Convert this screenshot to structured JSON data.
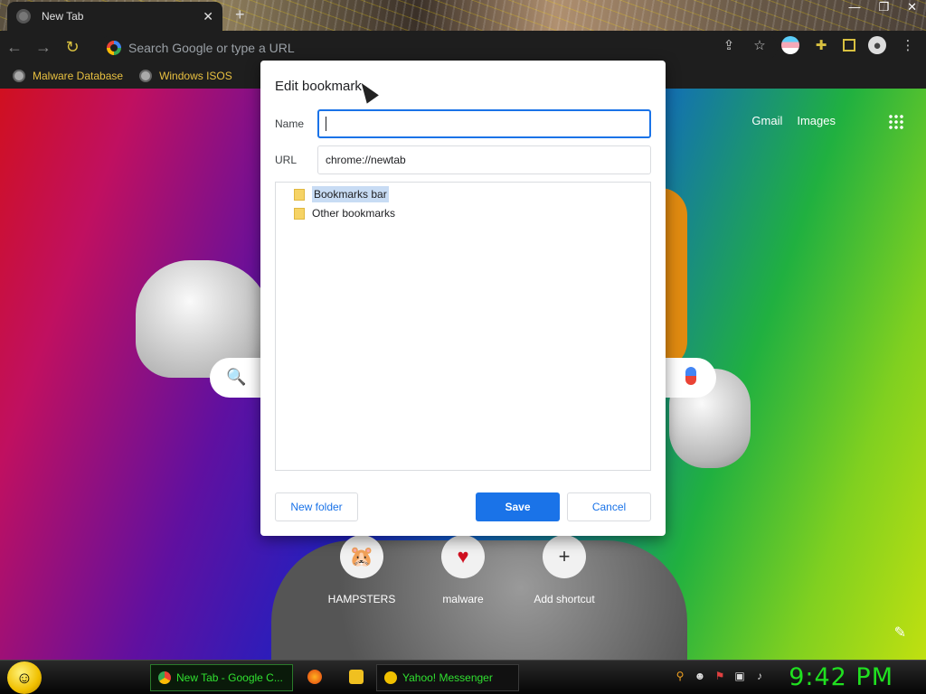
{
  "browser": {
    "tab_title": "New Tab",
    "tab_close": "✕",
    "new_tab": "+",
    "window_controls": [
      "—",
      "❐",
      "✕"
    ],
    "omnibox_placeholder": "Search Google or type a URL",
    "bookmarks": [
      "Malware Database",
      "Windows ISOS"
    ]
  },
  "ntp": {
    "gmail": "Gmail",
    "images": "Images",
    "shortcuts": [
      {
        "label": "HAMPSTERS",
        "icon": "🐹"
      },
      {
        "label": "malware",
        "icon": "♥"
      },
      {
        "label": "Add shortcut",
        "icon": "+"
      }
    ]
  },
  "dialog": {
    "title": "Edit bookmark",
    "name_label": "Name",
    "name_value": "",
    "url_label": "URL",
    "url_value": "chrome://newtab",
    "folders": [
      "Bookmarks bar",
      "Other bookmarks"
    ],
    "selected_folder": "Bookmarks bar",
    "new_folder_label": "New folder",
    "save_label": "Save",
    "cancel_label": "Cancel"
  },
  "taskbar": {
    "tasks": [
      {
        "label": "New Tab - Google C..."
      },
      {
        "label": "Yahoo! Messenger"
      }
    ],
    "clock": "9:42 PM"
  },
  "colors": {
    "accent": "#1a73e8",
    "taskbar_text": "#30e030",
    "bookmark_text": "#e8c040"
  }
}
